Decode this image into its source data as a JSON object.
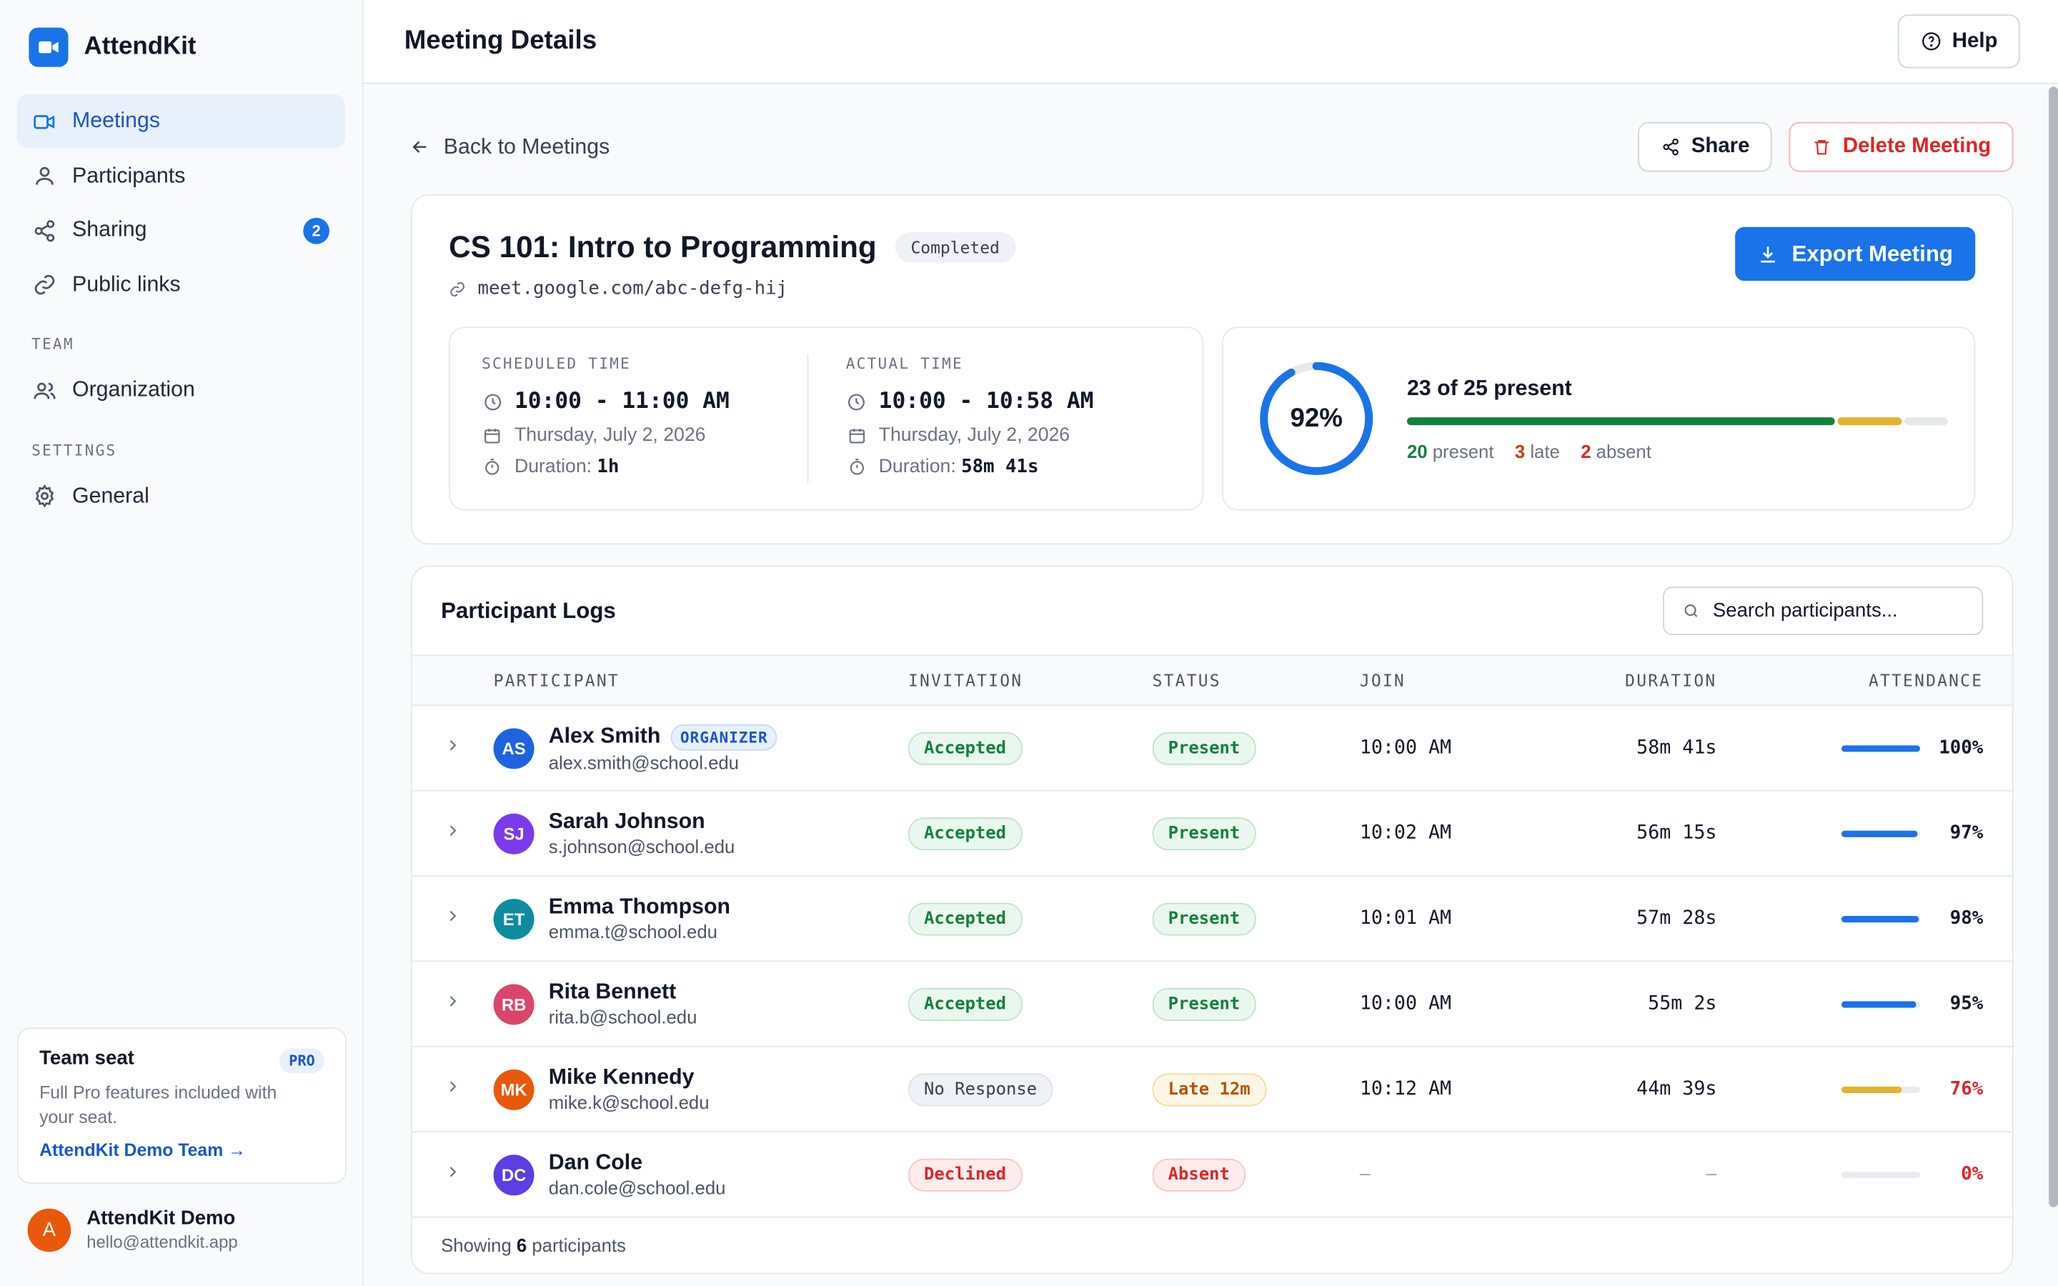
{
  "brand": {
    "name": "AttendKit",
    "logo_icon": "video-camera-icon",
    "color": "#1a73e8"
  },
  "sidebar": {
    "items": [
      {
        "label": "Meetings",
        "icon": "video-icon",
        "active": true
      },
      {
        "label": "Participants",
        "icon": "user-icon"
      },
      {
        "label": "Sharing",
        "icon": "share-icon",
        "badge": "2"
      },
      {
        "label": "Public links",
        "icon": "link-icon"
      }
    ],
    "team_label": "TEAM",
    "team_items": [
      {
        "label": "Organization",
        "icon": "users-icon"
      }
    ],
    "settings_label": "SETTINGS",
    "settings_items": [
      {
        "label": "General",
        "icon": "gear-icon"
      }
    ],
    "seat": {
      "title": "Team seat",
      "badge": "PRO",
      "description": "Full Pro features included with your seat.",
      "link": "AttendKit Demo Team →"
    },
    "user": {
      "initial": "A",
      "name": "AttendKit Demo",
      "email": "hello@attendkit.app"
    }
  },
  "header": {
    "title": "Meeting Details",
    "help_label": "Help"
  },
  "actions": {
    "back_label": "Back to Meetings",
    "share_label": "Share",
    "delete_label": "Delete Meeting"
  },
  "meeting": {
    "title": "CS 101: Intro to Programming",
    "status": "Completed",
    "link": "meet.google.com/abc-defg-hij",
    "export_label": "Export Meeting",
    "scheduled": {
      "label": "SCHEDULED TIME",
      "time": "10:00 - 11:00 AM",
      "date": "Thursday, July 2, 2026",
      "duration_label": "Duration:",
      "duration": "1h"
    },
    "actual": {
      "label": "ACTUAL TIME",
      "time": "10:00 - 10:58 AM",
      "date": "Thursday, July 2, 2026",
      "duration_label": "Duration:",
      "duration": "58m 41s"
    },
    "attendance": {
      "percent_label": "92%",
      "percent": 0.92,
      "headline": "23 of 25 present",
      "present_count": "20",
      "present_word": "present",
      "late_count": "3",
      "late_word": "late",
      "absent_count": "2",
      "absent_word": "absent",
      "present": 20,
      "late": 3,
      "absent": 2,
      "total": 25,
      "colors": {
        "present": "#15803d",
        "late": "#e5b42e",
        "absent": "#dc2626",
        "track": "#e5e7eb",
        "ring": "#1a73e8"
      }
    }
  },
  "logs": {
    "title": "Participant Logs",
    "search_placeholder": "Search participants...",
    "columns": {
      "participant": "PARTICIPANT",
      "invitation": "INVITATION",
      "status": "STATUS",
      "join": "JOIN",
      "duration": "DURATION",
      "attendance": "ATTENDANCE"
    },
    "rows": [
      {
        "initials": "AS",
        "avatar_color": "#1d63e0",
        "name": "Alex Smith",
        "badge": "ORGANIZER",
        "email": "alex.smith@school.edu",
        "invitation": "Accepted",
        "invitation_tone": "green",
        "status": "Present",
        "status_tone": "green",
        "join": "10:00 AM",
        "duration": "58m 41s",
        "attendance": 1.0,
        "attendance_label": "100%",
        "bar_color": "#1a73e8",
        "pct_color": "#111827"
      },
      {
        "initials": "SJ",
        "avatar_color": "#7c3aed",
        "name": "Sarah Johnson",
        "badge": "",
        "email": "s.johnson@school.edu",
        "invitation": "Accepted",
        "invitation_tone": "green",
        "status": "Present",
        "status_tone": "green",
        "join": "10:02 AM",
        "duration": "56m 15s",
        "attendance": 0.97,
        "attendance_label": "97%",
        "bar_color": "#1a73e8",
        "pct_color": "#111827"
      },
      {
        "initials": "ET",
        "avatar_color": "#0e8c9e",
        "name": "Emma Thompson",
        "badge": "",
        "email": "emma.t@school.edu",
        "invitation": "Accepted",
        "invitation_tone": "green",
        "status": "Present",
        "status_tone": "green",
        "join": "10:01 AM",
        "duration": "57m 28s",
        "attendance": 0.98,
        "attendance_label": "98%",
        "bar_color": "#1a73e8",
        "pct_color": "#111827"
      },
      {
        "initials": "RB",
        "avatar_color": "#d9466a",
        "name": "Rita Bennett",
        "badge": "",
        "email": "rita.b@school.edu",
        "invitation": "Accepted",
        "invitation_tone": "green",
        "status": "Present",
        "status_tone": "green",
        "join": "10:00 AM",
        "duration": "55m 2s",
        "attendance": 0.95,
        "attendance_label": "95%",
        "bar_color": "#1a73e8",
        "pct_color": "#111827"
      },
      {
        "initials": "MK",
        "avatar_color": "#ea580c",
        "name": "Mike Kennedy",
        "badge": "",
        "email": "mike.k@school.edu",
        "invitation": "No Response",
        "invitation_tone": "gray",
        "status": "Late 12m",
        "status_tone": "amber",
        "join": "10:12 AM",
        "duration": "44m 39s",
        "attendance": 0.76,
        "attendance_label": "76%",
        "bar_color": "#e5b42e",
        "pct_color": "#dc2626"
      },
      {
        "initials": "DC",
        "avatar_color": "#5b3fe0",
        "name": "Dan Cole",
        "badge": "",
        "email": "dan.cole@school.edu",
        "invitation": "Declined",
        "invitation_tone": "red",
        "status": "Absent",
        "status_tone": "red",
        "join": "–",
        "duration": "–",
        "attendance": 0.0,
        "attendance_label": "0%",
        "bar_color": "#e5e7eb",
        "pct_color": "#dc2626"
      }
    ],
    "footer_prefix": "Showing",
    "footer_count": "6",
    "footer_suffix": "participants"
  }
}
